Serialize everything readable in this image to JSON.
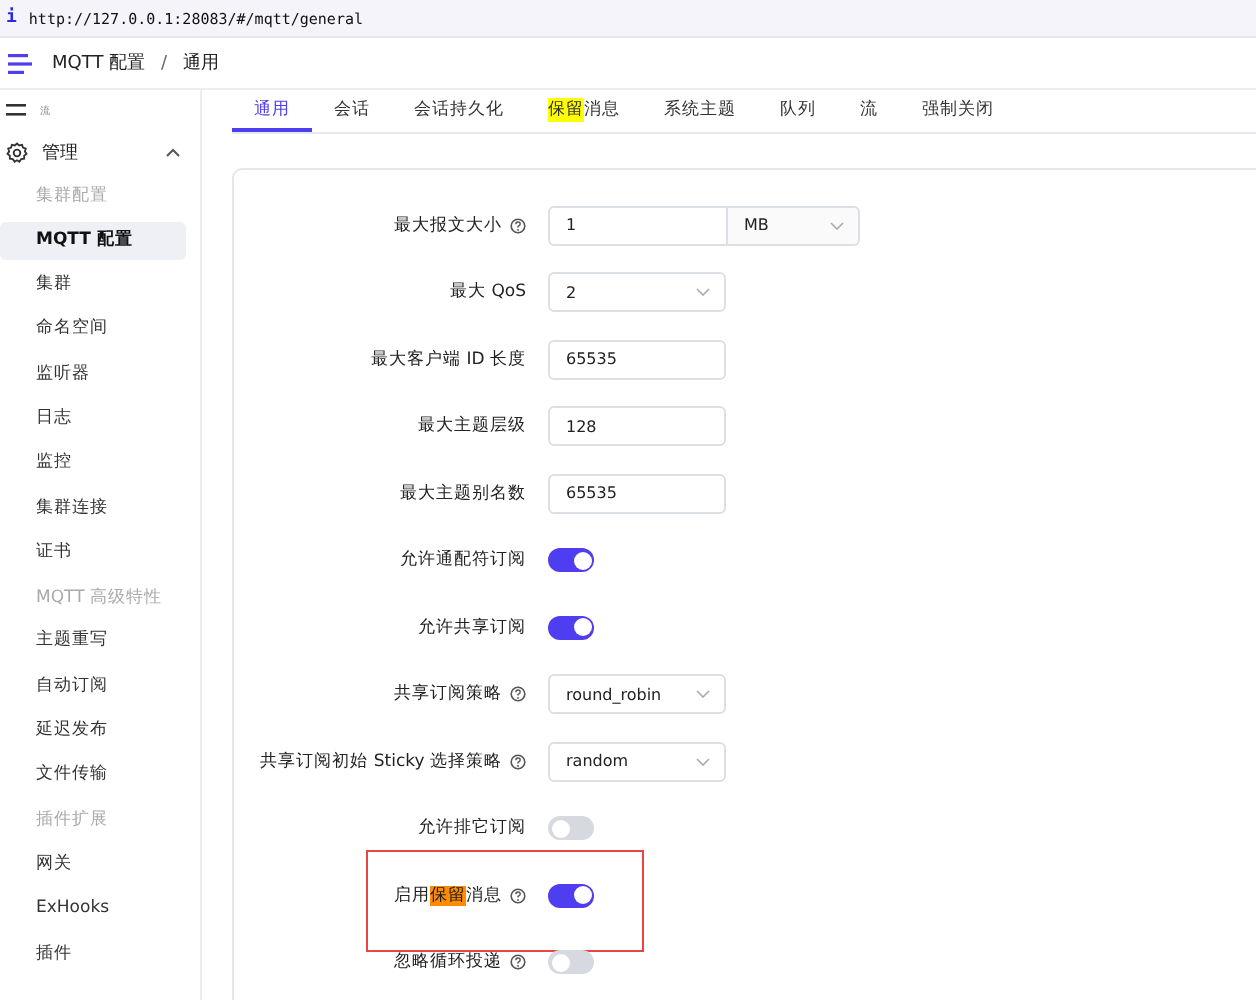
{
  "address_bar": {
    "info_glyph": "i",
    "url": "http://127.0.0.1:28083/#/mqtt/general"
  },
  "header": {
    "breadcrumb": [
      "MQTT 配置",
      "通用"
    ],
    "separator": "/"
  },
  "sidebar": {
    "items": [
      {
        "kind": "top",
        "label": "流"
      },
      {
        "kind": "top",
        "label": "管理",
        "expanded": true
      },
      {
        "kind": "group",
        "label": "集群配置"
      },
      {
        "kind": "item",
        "label": "MQTT 配置",
        "selected": true
      },
      {
        "kind": "item",
        "label": "集群",
        "selected": false
      },
      {
        "kind": "item",
        "label": "命名空间",
        "selected": false
      },
      {
        "kind": "item",
        "label": "监听器",
        "selected": false
      },
      {
        "kind": "item",
        "label": "日志",
        "selected": false
      },
      {
        "kind": "item",
        "label": "监控",
        "selected": false
      },
      {
        "kind": "item",
        "label": "集群连接",
        "selected": false
      },
      {
        "kind": "item",
        "label": "证书",
        "selected": false
      },
      {
        "kind": "group",
        "label": "MQTT 高级特性"
      },
      {
        "kind": "item",
        "label": "主题重写",
        "selected": false
      },
      {
        "kind": "item",
        "label": "自动订阅",
        "selected": false
      },
      {
        "kind": "item",
        "label": "延迟发布",
        "selected": false
      },
      {
        "kind": "item",
        "label": "文件传输",
        "selected": false
      },
      {
        "kind": "group",
        "label": "插件扩展"
      },
      {
        "kind": "item",
        "label": "网关",
        "selected": false
      },
      {
        "kind": "item",
        "label": "ExHooks",
        "selected": false
      },
      {
        "kind": "item",
        "label": "插件",
        "selected": false
      }
    ]
  },
  "tabs": [
    {
      "parts": [
        {
          "text": "通用"
        }
      ],
      "selected": true
    },
    {
      "parts": [
        {
          "text": "会话"
        }
      ],
      "selected": false
    },
    {
      "parts": [
        {
          "text": "会话持久化"
        }
      ],
      "selected": false
    },
    {
      "parts": [
        {
          "text": "保留",
          "color": "#ffff00"
        },
        {
          "text": "消息"
        }
      ],
      "selected": false
    },
    {
      "parts": [
        {
          "text": "系统主题"
        }
      ],
      "selected": false
    },
    {
      "parts": [
        {
          "text": "队列"
        }
      ],
      "selected": false
    },
    {
      "parts": [
        {
          "text": "流"
        }
      ],
      "selected": false
    },
    {
      "parts": [
        {
          "text": "强制关闭"
        }
      ],
      "selected": false
    }
  ],
  "form": {
    "fields": [
      {
        "kind": "input_unit",
        "label": [
          {
            "text": "最大报文大小"
          }
        ],
        "help": true,
        "value": "1",
        "unit": "MB",
        "annotated": false
      },
      {
        "kind": "select",
        "label": [
          {
            "text": "最大 QoS"
          }
        ],
        "help": false,
        "value": "2",
        "annotated": false
      },
      {
        "kind": "input",
        "label": [
          {
            "text": "最大客户端 ID 长度"
          }
        ],
        "help": false,
        "value": "65535",
        "annotated": false
      },
      {
        "kind": "input",
        "label": [
          {
            "text": "最大主题层级"
          }
        ],
        "help": false,
        "value": "128",
        "annotated": false
      },
      {
        "kind": "input",
        "label": [
          {
            "text": "最大主题别名数"
          }
        ],
        "help": false,
        "value": "65535",
        "annotated": false
      },
      {
        "kind": "switch",
        "label": [
          {
            "text": "允许通配符订阅"
          }
        ],
        "help": false,
        "on": true,
        "annotated": false
      },
      {
        "kind": "switch",
        "label": [
          {
            "text": "允许共享订阅"
          }
        ],
        "help": false,
        "on": true,
        "annotated": false
      },
      {
        "kind": "select",
        "label": [
          {
            "text": "共享订阅策略"
          }
        ],
        "help": true,
        "value": "round_robin",
        "annotated": false
      },
      {
        "kind": "select",
        "label": [
          {
            "text": "共享订阅初始 Sticky 选择策略"
          }
        ],
        "help": true,
        "value": "random",
        "annotated": false
      },
      {
        "kind": "switch",
        "label": [
          {
            "text": "允许排它订阅"
          }
        ],
        "help": false,
        "on": false,
        "annotated": false
      },
      {
        "kind": "switch",
        "label": [
          {
            "text": "启用"
          },
          {
            "text": "保留",
            "color": "#ff8c00"
          },
          {
            "text": "消息"
          }
        ],
        "help": true,
        "on": true,
        "annotated": true
      },
      {
        "kind": "switch",
        "label": [
          {
            "text": "忽略循环投递"
          }
        ],
        "help": true,
        "on": false,
        "annotated": false
      }
    ]
  }
}
